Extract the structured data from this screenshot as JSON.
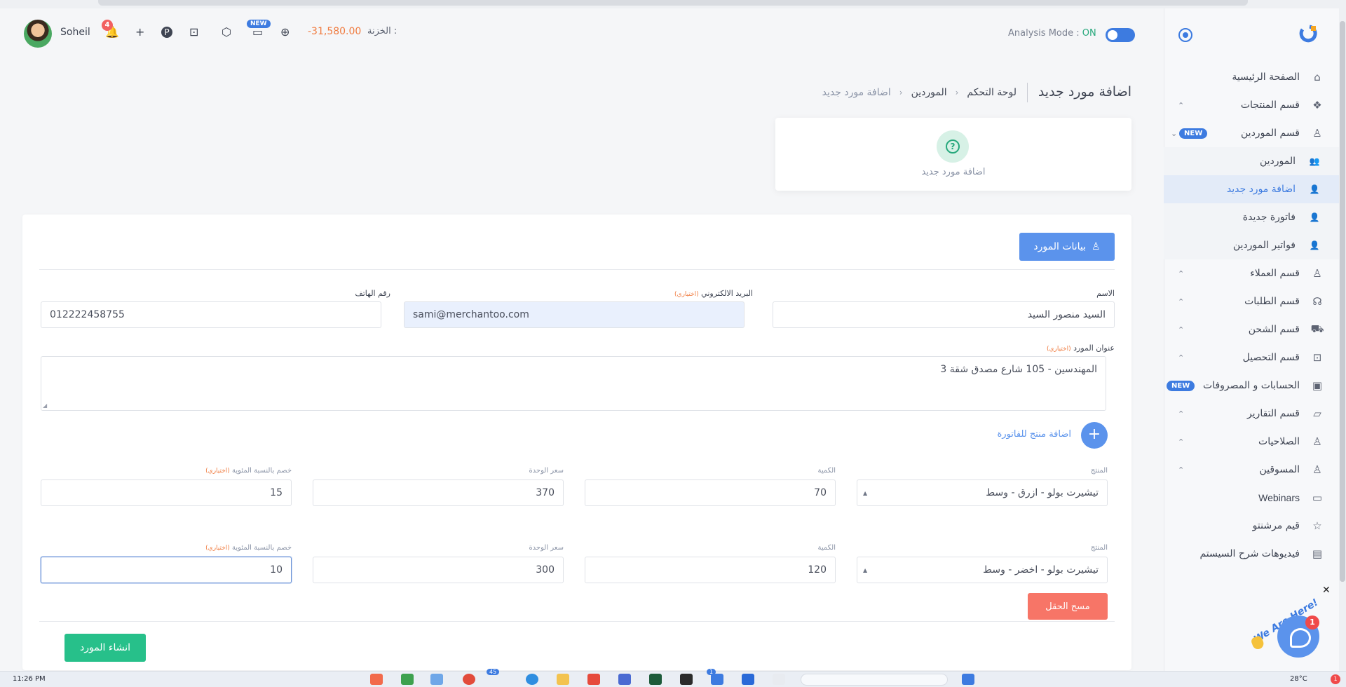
{
  "topbar": {
    "username": "Soheil",
    "notification_count": "4",
    "new_badge": "NEW",
    "treasury_label": "الخزنة :",
    "treasury_value": "-31,580.00",
    "analysis_label": "Analysis Mode :",
    "analysis_state": "ON",
    "icons": [
      "bell-icon",
      "plus-icon",
      "parking-icon",
      "camera-icon",
      "box-icon",
      "chat-icon",
      "globe-icon"
    ]
  },
  "sidebar": {
    "items": [
      {
        "label": "الصفحة الرئيسية",
        "icon": "home-icon"
      },
      {
        "label": "قسم المنتجات",
        "icon": "products-icon"
      },
      {
        "label": "قسم الموردين",
        "icon": "user-icon",
        "badge": "NEW"
      },
      {
        "label": "الموردين",
        "icon": "user-list-icon"
      },
      {
        "label": "اضافة مورد جديد",
        "icon": "user-plus-icon"
      },
      {
        "label": "فاتورة جديدة",
        "icon": "user-plus-icon"
      },
      {
        "label": "فواتير الموردين",
        "icon": "user-plus-icon"
      },
      {
        "label": "قسم العملاء",
        "icon": "user-icon"
      },
      {
        "label": "قسم الطلبات",
        "icon": "headset-icon"
      },
      {
        "label": "قسم الشحن",
        "icon": "truck-icon"
      },
      {
        "label": "قسم التحصيل",
        "icon": "money-icon"
      },
      {
        "label": "الحسابات و المصروفات",
        "icon": "wallet-icon",
        "badge": "NEW"
      },
      {
        "label": "قسم التقارير",
        "icon": "report-icon"
      },
      {
        "label": "الصلاحيات",
        "icon": "user-icon"
      },
      {
        "label": "المسوقين",
        "icon": "user-icon"
      },
      {
        "label": "Webinars",
        "icon": "video-icon"
      },
      {
        "label": "قيم مرشنتو",
        "icon": "star-icon"
      },
      {
        "label": "فيديوهات شرح السيستم",
        "icon": "book-icon"
      }
    ]
  },
  "header": {
    "title": "اضافة مورد جديد",
    "breadcrumbs": [
      "لوحة التحكم",
      "الموردين",
      "اضافة مورد جديد"
    ]
  },
  "step_card": {
    "label": "اضافة مورد جديد",
    "icon": "question-icon"
  },
  "form": {
    "tab_label": "بيانات المورد",
    "name_label": "الاسم",
    "name_value": "السيد منصور السيد",
    "email_label": "البريد الالكتروني",
    "optional": "(اختياري)",
    "email_value": "sami@merchantoo.com",
    "phone_label": "رقم الهاتف",
    "phone_value": "012222458755",
    "address_label": "عنوان المورد",
    "address_value": "المهندسين - 105 شارع مصدق شقة 3",
    "add_product_label": "اضافة منتج للفاتورة",
    "col_product": "المنتج",
    "col_qty": "الكمية",
    "col_unit_price": "سعر الوحدة",
    "col_discount": "خصم بالنسبة المئوية",
    "rows": [
      {
        "product": "تيشيرت بولو - ازرق - وسط",
        "qty": "70",
        "price": "370",
        "discount": "15"
      },
      {
        "product": "تيشيرت بولو - اخضر - وسط",
        "qty": "120",
        "price": "300",
        "discount": "10"
      }
    ],
    "clear_label": "مسح الحقل",
    "submit_label": "انشاء المورد"
  },
  "chat": {
    "tagline": "We Are Here!",
    "count": "1"
  },
  "taskbar": {
    "time": "11:26 PM",
    "temperature": "28°C",
    "badge_45": "45",
    "badge_1": "1",
    "notif": "1"
  }
}
